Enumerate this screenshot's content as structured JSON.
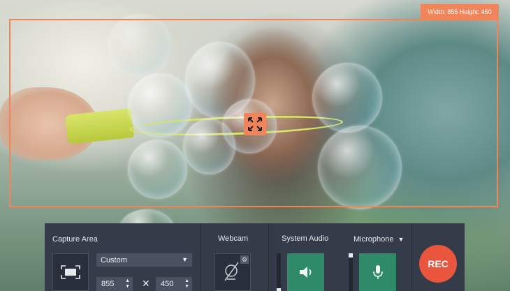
{
  "overlay": {
    "dimensions_label": "Width: 855 Height: 450",
    "frame_color": "#f0845a"
  },
  "panel": {
    "capture_area": {
      "title": "Capture Area",
      "preset": "Custom",
      "width": "855",
      "height": "450",
      "times": "✕"
    },
    "webcam": {
      "title": "Webcam",
      "state": "off"
    },
    "system_audio": {
      "title": "System Audio",
      "state": "on"
    },
    "microphone": {
      "title": "Microphone",
      "dropdown": "▼",
      "state": "on"
    },
    "rec": {
      "label": "REC",
      "color": "#e9553d"
    }
  },
  "colors": {
    "panel_bg": "#353c49",
    "green": "#2f8a6a",
    "accent": "#f0845a"
  }
}
